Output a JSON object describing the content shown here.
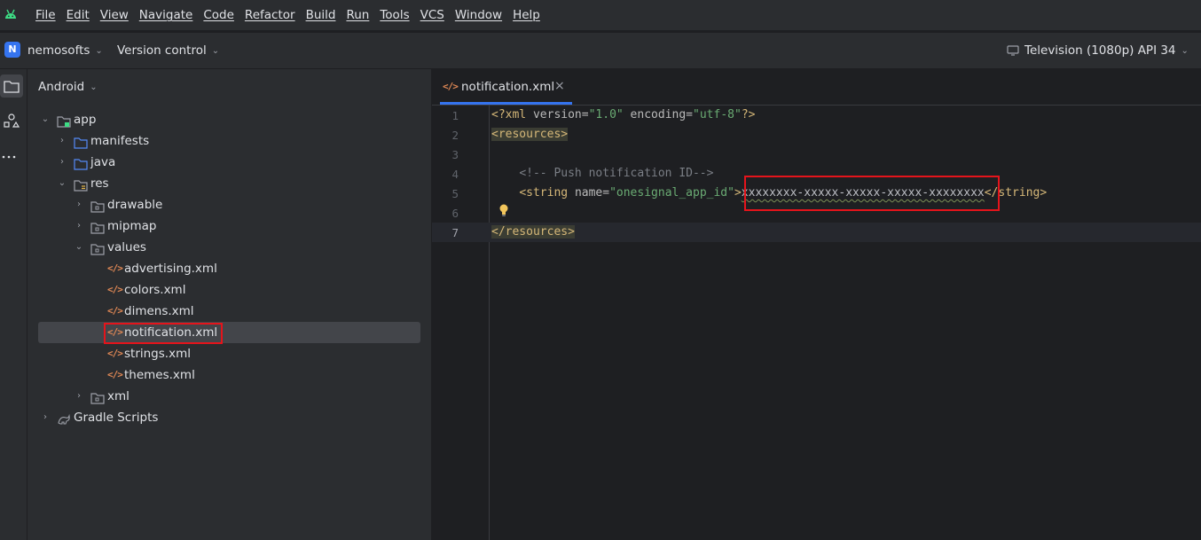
{
  "menu": [
    "File",
    "Edit",
    "View",
    "Navigate",
    "Code",
    "Refactor",
    "Build",
    "Run",
    "Tools",
    "VCS",
    "Window",
    "Help"
  ],
  "toolbar": {
    "project_initial": "N",
    "project_name": "nemosofts",
    "vcs_label": "Version control",
    "device_label": "Television (1080p) API 34"
  },
  "project_panel": {
    "view_label": "Android",
    "tree": [
      {
        "label": "app"
      },
      {
        "label": "manifests"
      },
      {
        "label": "java"
      },
      {
        "label": "res"
      },
      {
        "label": "drawable"
      },
      {
        "label": "mipmap"
      },
      {
        "label": "values"
      },
      {
        "label": "advertising.xml"
      },
      {
        "label": "colors.xml"
      },
      {
        "label": "dimens.xml"
      },
      {
        "label": "notification.xml"
      },
      {
        "label": "strings.xml"
      },
      {
        "label": "themes.xml"
      },
      {
        "label": "xml"
      },
      {
        "label": "Gradle Scripts"
      }
    ]
  },
  "editor": {
    "tab_label": "notification.xml",
    "tab_close": "×",
    "line_numbers": [
      "1",
      "2",
      "3",
      "4",
      "5",
      "6",
      "7"
    ],
    "code": {
      "l1_decl_open": "<?xml ",
      "l1_attr1": "version=",
      "l1_val1": "\"1.0\"",
      "l1_attr2": " encoding=",
      "l1_val2": "\"utf-8\"",
      "l1_decl_close": "?>",
      "l2": "<resources>",
      "l4": "<!-- Push notification ID-->",
      "l5_open": "<string ",
      "l5_attr": "name=",
      "l5_val": "\"onesignal_app_id\"",
      "l5_gt": ">",
      "l5_text": "xxxxxxxx-xxxxx-xxxxx-xxxxx-xxxxxxxx",
      "l5_close": "</string>",
      "l7": "</resources>"
    }
  },
  "colors": {
    "accent": "#3574f0",
    "highlight_box": "#e5141b"
  }
}
